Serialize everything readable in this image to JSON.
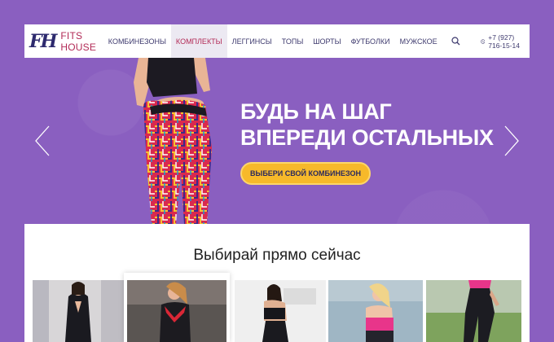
{
  "header": {
    "logo_mark": "FH",
    "logo_text": "FITS HOUSE",
    "nav": [
      {
        "label": "КОМБИНЕЗОНЫ",
        "active": false
      },
      {
        "label": "КОМПЛЕКТЫ",
        "active": true
      },
      {
        "label": "ЛЕГГИНСЫ",
        "active": false
      },
      {
        "label": "ТОПЫ",
        "active": false
      },
      {
        "label": "ШОРТЫ",
        "active": false
      },
      {
        "label": "ФУТБОЛКИ",
        "active": false
      },
      {
        "label": "МУЖСКОЕ",
        "active": false
      }
    ],
    "search_icon": "search-icon",
    "phone_icon": "phone-icon",
    "phone": "+7 (927) 716-15-14"
  },
  "hero": {
    "headline_line1": "БУДЬ НА ШАГ",
    "headline_line2": "ВПЕРЕДИ ОСТАЛЬНЫХ",
    "cta_label": "ВЫБЕРИ СВОЙ КОМБИНЕЗОН",
    "prev_icon": "chevron-left-icon",
    "next_icon": "chevron-right-icon"
  },
  "catalog": {
    "title": "Выбирай прямо сейчас",
    "products": [
      {
        "name": "product-1"
      },
      {
        "name": "product-2"
      },
      {
        "name": "product-3"
      },
      {
        "name": "product-4"
      },
      {
        "name": "product-5"
      }
    ]
  },
  "colors": {
    "background": "#8a5fc0",
    "accent": "#b22a56",
    "cta": "#f7b92a",
    "nav_text": "#3e3a6e"
  }
}
